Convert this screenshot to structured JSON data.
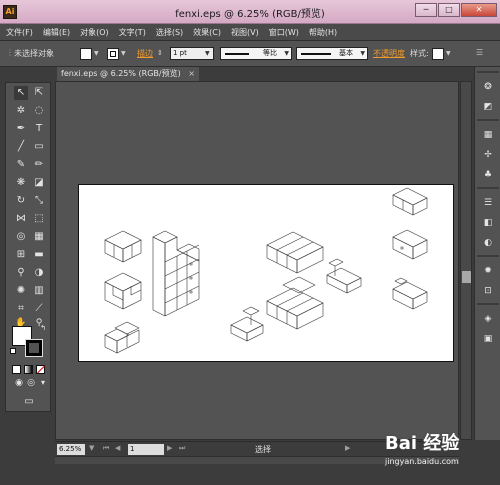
{
  "window": {
    "title": "fenxi.eps @ 6.25% (RGB/预览)",
    "app_icon": "Ai",
    "buttons": [
      "─",
      "□",
      "✕"
    ]
  },
  "menu": [
    "文件(F)",
    "编辑(E)",
    "对象(O)",
    "文字(T)",
    "选择(S)",
    "效果(C)",
    "视图(V)",
    "窗口(W)",
    "帮助(H)"
  ],
  "control_bar": {
    "selection_label": "未选择对象",
    "stroke_label": "描边",
    "stroke_weight": "1 pt",
    "stroke_profile": "等比",
    "brush": "基本",
    "opacity_label": "不透明度",
    "style_label": "样式:"
  },
  "document_tab": {
    "label": "fenxi.eps @ 6.25% (RGB/预览)",
    "close": "×"
  },
  "status_bar": {
    "zoom": "6.25%",
    "page": "1",
    "status": "选择"
  },
  "watermark": {
    "main": "Bai 经验",
    "sub": "jingyan.baidu.com"
  },
  "colors": {
    "accent_orange": "#f29b2c",
    "panel_bg": "#535353",
    "workspace_bg": "#3c3c3c",
    "titlebar": "#d4a9c4"
  },
  "icons": {
    "tools": [
      "selection-tool",
      "direct-selection-tool",
      "magic-wand-tool",
      "lasso-tool",
      "pen-tool",
      "type-tool",
      "line-tool",
      "rectangle-tool",
      "paintbrush-tool",
      "pencil-tool",
      "blob-brush-tool",
      "eraser-tool",
      "rotate-tool",
      "scale-tool",
      "width-tool",
      "free-transform-tool",
      "shape-builder-tool",
      "perspective-grid-tool",
      "mesh-tool",
      "gradient-tool",
      "eyedropper-tool",
      "blend-tool",
      "symbol-sprayer-tool",
      "column-graph-tool",
      "artboard-tool",
      "slice-tool",
      "hand-tool",
      "zoom-tool"
    ],
    "dock": [
      "color-panel",
      "color-guide-panel",
      "swatches-panel",
      "brushes-panel",
      "symbols-panel",
      "stroke-panel",
      "gradient-panel",
      "transparency-panel",
      "appearance-panel",
      "graphic-styles-panel",
      "layers-panel",
      "artboards-panel"
    ]
  }
}
